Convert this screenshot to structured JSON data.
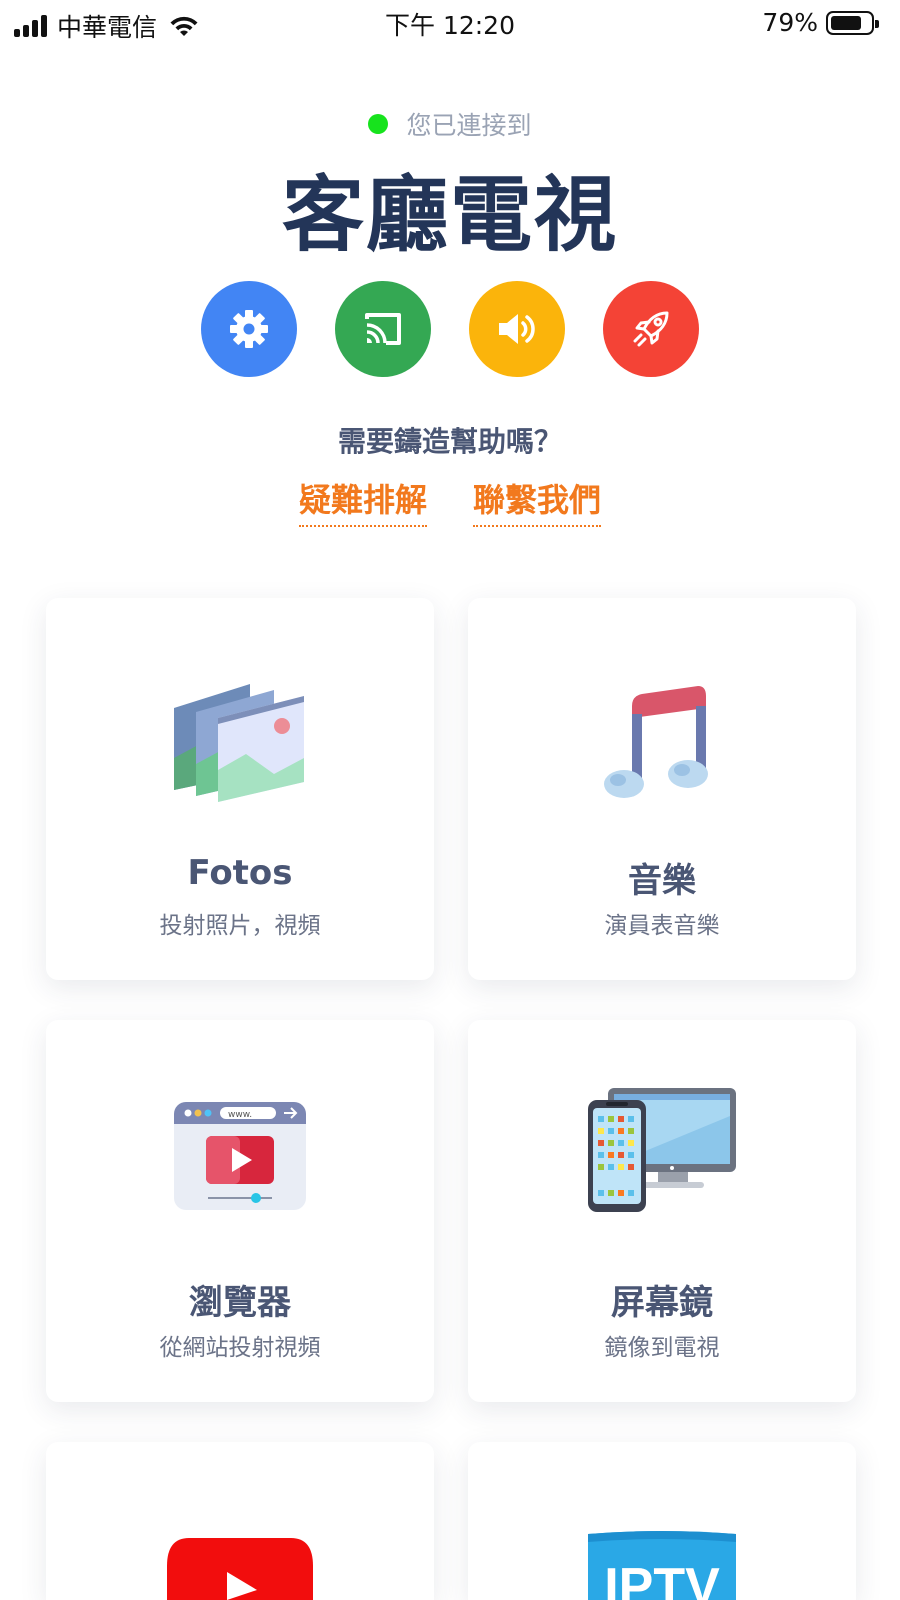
{
  "status_bar": {
    "carrier": "中華電信",
    "time": "下午 12:20",
    "battery": "79%",
    "battery_level": 0.79
  },
  "header": {
    "connected_text": "您已連接到",
    "device_name": "客廳電視"
  },
  "actions": [
    {
      "icon": "gear-icon",
      "color": "#4285f4"
    },
    {
      "icon": "cast-icon",
      "color": "#34a853"
    },
    {
      "icon": "volume-icon",
      "color": "#fbb40b"
    },
    {
      "icon": "rocket-icon",
      "color": "#f44336"
    }
  ],
  "help": {
    "question": "需要鑄造幫助嗎？",
    "troubleshoot": "疑難排解",
    "contact": "聯繫我們"
  },
  "cards": [
    {
      "title": "Fotos",
      "subtitle": "投射照片，視頻",
      "icon": "photos-icon"
    },
    {
      "title": "音樂",
      "subtitle": "演員表音樂",
      "icon": "music-icon"
    },
    {
      "title": "瀏覽器",
      "subtitle": "從網站投射視頻",
      "icon": "browser-icon"
    },
    {
      "title": "屏幕鏡",
      "subtitle": "鏡像到電視",
      "icon": "screen-mirror-icon"
    },
    {
      "title": "",
      "subtitle": "",
      "icon": "youtube-icon"
    },
    {
      "title": "",
      "subtitle": "",
      "icon": "iptv-icon",
      "icon_text": "IPTV"
    }
  ],
  "colors": {
    "accent_orange": "#f2791d",
    "title_navy": "#233558",
    "connected_green": "#17e31d"
  }
}
